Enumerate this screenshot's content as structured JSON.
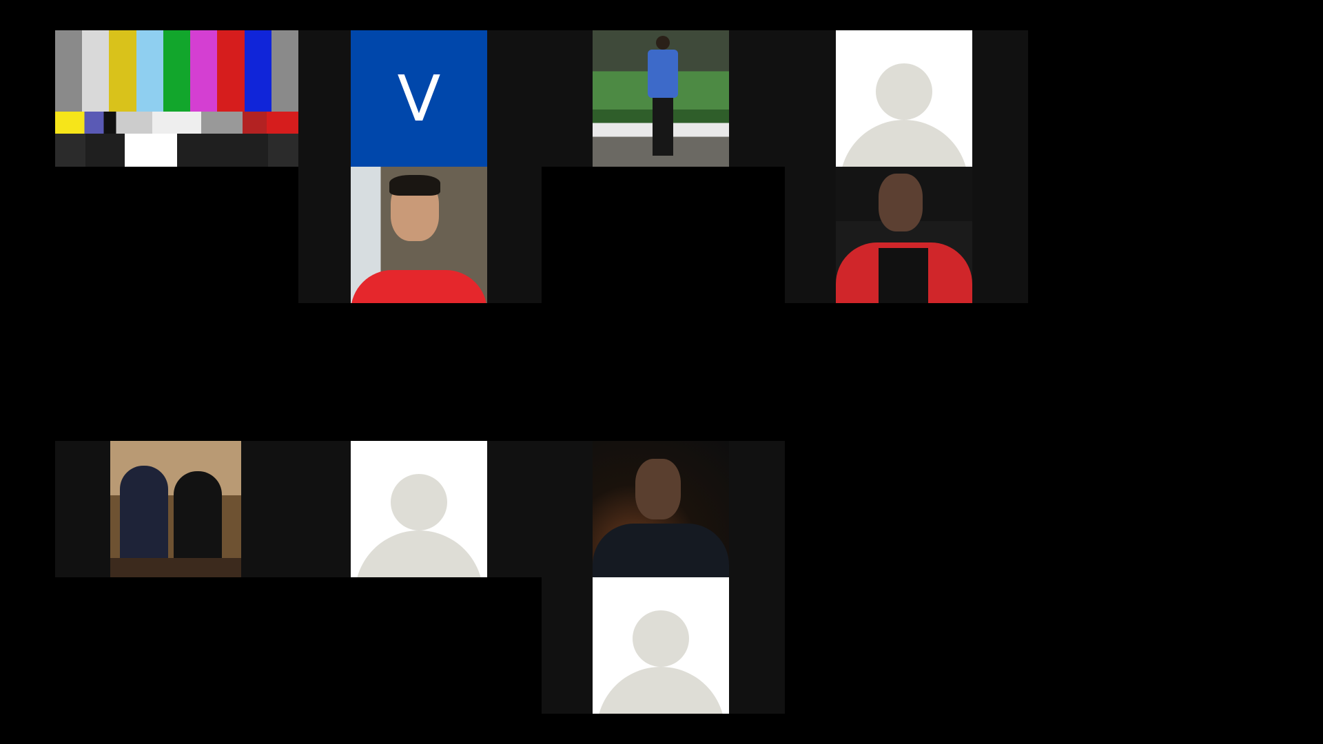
{
  "meeting": {
    "tiles": [
      {
        "id": "p1",
        "type": "test-pattern"
      },
      {
        "id": "p2",
        "type": "initial",
        "initial": "V",
        "color": "#0047ab"
      },
      {
        "id": "p3",
        "type": "video"
      },
      {
        "id": "p4",
        "type": "avatar"
      },
      {
        "id": "p5",
        "type": "video"
      },
      {
        "id": "p6",
        "type": "video"
      },
      {
        "id": "p7",
        "type": "video"
      },
      {
        "id": "p8",
        "type": "avatar"
      },
      {
        "id": "p9",
        "type": "video"
      },
      {
        "id": "p10",
        "type": "avatar"
      }
    ],
    "test_pattern_colors": [
      "#8a8a8a",
      "#d9d9d9",
      "#d9c21b",
      "#8fcff0",
      "#12a62c",
      "#d43fd2",
      "#d61d1d",
      "#1025d9",
      "#8a8a8a"
    ],
    "background": "#000000",
    "tile_background": "#111111",
    "avatar_color": "#deddd6"
  }
}
